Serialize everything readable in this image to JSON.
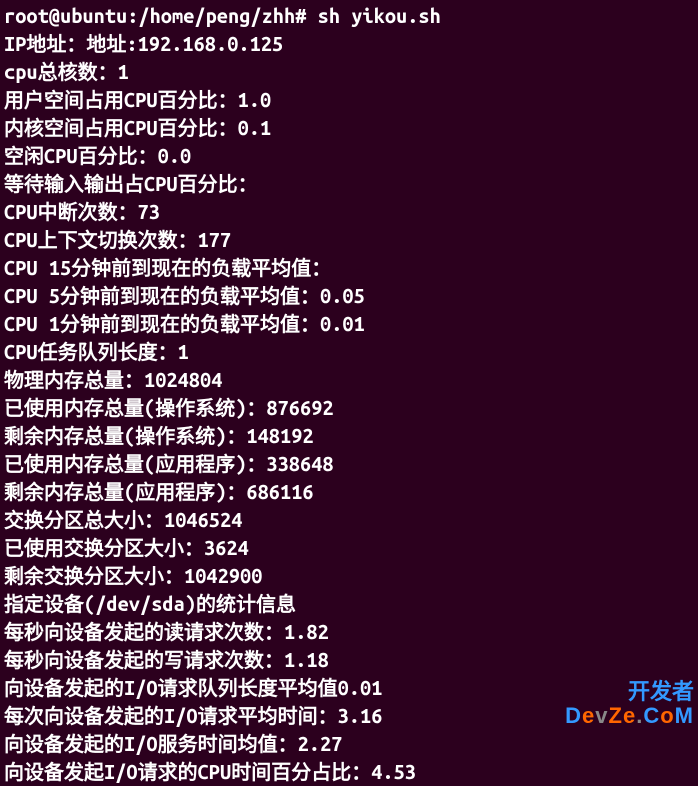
{
  "prompt": {
    "user": "root@ubuntu",
    "path": "/home/peng/zhh",
    "symbol": "#",
    "command": "sh yikou.sh"
  },
  "lines": [
    "IP地址：地址:192.168.0.125",
    "cpu总核数：1",
    "用户空间占用CPU百分比：1.0",
    "内核空间占用CPU百分比：0.1",
    "空闲CPU百分比：0.0",
    "等待输入输出占CPU百分比：",
    "CPU中断次数：73",
    "CPU上下文切换次数：177",
    "CPU 15分钟前到现在的负载平均值：",
    "CPU 5分钟前到现在的负载平均值：0.05",
    "CPU 1分钟前到现在的负载平均值：0.01",
    "CPU任务队列长度：1",
    "物理内存总量：1024804",
    "已使用内存总量(操作系统)：876692",
    "剩余内存总量(操作系统)：148192",
    "已使用内存总量(应用程序)：338648",
    "剩余内存总量(应用程序)：686116",
    "交换分区总大小：1046524",
    "已使用交换分区大小：3624",
    "剩余交换分区大小：1042900",
    "指定设备(/dev/sda)的统计信息",
    "每秒向设备发起的读请求次数：1.82",
    "每秒向设备发起的写请求次数：1.18",
    "向设备发起的I/O请求队列长度平均值0.01",
    "每次向设备发起的I/O请求平均时间：3.16",
    "向设备发起的I/O服务时间均值：2.27",
    "向设备发起I/O请求的CPU时间百分占比：4.53"
  ],
  "watermark": {
    "cn": "开发者",
    "en": [
      "D",
      "e",
      "v",
      "Z",
      "e",
      ".",
      "C",
      "o",
      "M"
    ]
  }
}
